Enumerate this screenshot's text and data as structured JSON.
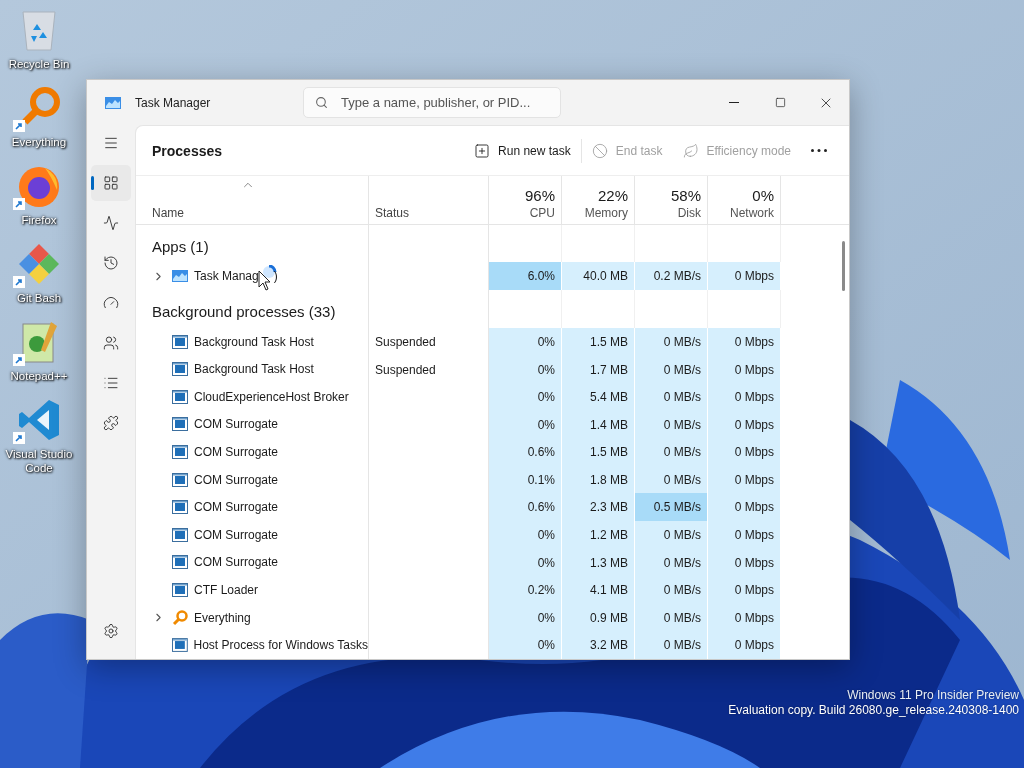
{
  "desktop_icons": [
    {
      "kind": "recycle",
      "label": "Recycle Bin",
      "shortcut": false
    },
    {
      "kind": "search",
      "label": "Everything",
      "shortcut": true
    },
    {
      "kind": "firefox",
      "label": "Firefox",
      "shortcut": true
    },
    {
      "kind": "git",
      "label": "Git Bash",
      "shortcut": true
    },
    {
      "kind": "notepad",
      "label": "Notepad++",
      "shortcut": true
    },
    {
      "kind": "vscode",
      "label": "Visual Studio Code",
      "shortcut": true
    }
  ],
  "window": {
    "title": "Task Manager",
    "search": {
      "placeholder": "Type a name, publisher, or PID..."
    }
  },
  "nav": [
    {
      "kind": "menu",
      "selected": false
    },
    {
      "kind": "processes",
      "selected": true
    },
    {
      "kind": "performance",
      "selected": false
    },
    {
      "kind": "history",
      "selected": false
    },
    {
      "kind": "startup",
      "selected": false
    },
    {
      "kind": "users",
      "selected": false
    },
    {
      "kind": "details",
      "selected": false
    },
    {
      "kind": "services",
      "selected": false
    }
  ],
  "page_title": "Processes",
  "toolbar": [
    {
      "kind": "run",
      "label": "Run new task",
      "disabled": false
    },
    {
      "kind": "end",
      "label": "End task",
      "disabled": true
    },
    {
      "kind": "efficiency",
      "label": "Efficiency mode",
      "disabled": true
    }
  ],
  "columns": [
    {
      "label": "Name"
    },
    {
      "label": "Status"
    },
    {
      "percent": "96%",
      "label": "CPU"
    },
    {
      "percent": "22%",
      "label": "Memory"
    },
    {
      "percent": "58%",
      "label": "Disk"
    },
    {
      "percent": "0%",
      "label": "Network"
    }
  ],
  "groups": [
    {
      "title": "Apps (1)",
      "rows": [
        {
          "kind": "app",
          "name": "Task Manag",
          "name_tail": ")",
          "busy": true,
          "expandable": true,
          "status": "",
          "cells": [
            {
              "text": "6.0%",
              "hot": true
            },
            {
              "text": "40.0 MB",
              "hot": false
            },
            {
              "text": "0.2 MB/s",
              "hot": false
            },
            {
              "text": "0 Mbps",
              "hot": false
            }
          ]
        }
      ]
    },
    {
      "title": "Background processes (33)",
      "rows": [
        {
          "kind": "process",
          "name": "Background Task Host",
          "busy": false,
          "expandable": false,
          "status": "Suspended",
          "cells": [
            {
              "text": "0%",
              "hot": false
            },
            {
              "text": "1.5 MB",
              "hot": false
            },
            {
              "text": "0 MB/s",
              "hot": false
            },
            {
              "text": "0 Mbps",
              "hot": false
            }
          ]
        },
        {
          "kind": "process",
          "name": "Background Task Host",
          "busy": false,
          "expandable": false,
          "status": "Suspended",
          "cells": [
            {
              "text": "0%",
              "hot": false
            },
            {
              "text": "1.7 MB",
              "hot": false
            },
            {
              "text": "0 MB/s",
              "hot": false
            },
            {
              "text": "0 Mbps",
              "hot": false
            }
          ]
        },
        {
          "kind": "process",
          "name": "CloudExperienceHost Broker",
          "busy": false,
          "expandable": false,
          "status": "",
          "cells": [
            {
              "text": "0%",
              "hot": false
            },
            {
              "text": "5.4 MB",
              "hot": false
            },
            {
              "text": "0 MB/s",
              "hot": false
            },
            {
              "text": "0 Mbps",
              "hot": false
            }
          ]
        },
        {
          "kind": "process",
          "name": "COM Surrogate",
          "busy": false,
          "expandable": false,
          "status": "",
          "cells": [
            {
              "text": "0%",
              "hot": false
            },
            {
              "text": "1.4 MB",
              "hot": false
            },
            {
              "text": "0 MB/s",
              "hot": false
            },
            {
              "text": "0 Mbps",
              "hot": false
            }
          ]
        },
        {
          "kind": "process",
          "name": "COM Surrogate",
          "busy": false,
          "expandable": false,
          "status": "",
          "cells": [
            {
              "text": "0.6%",
              "hot": false
            },
            {
              "text": "1.5 MB",
              "hot": false
            },
            {
              "text": "0 MB/s",
              "hot": false
            },
            {
              "text": "0 Mbps",
              "hot": false
            }
          ]
        },
        {
          "kind": "process",
          "name": "COM Surrogate",
          "busy": false,
          "expandable": false,
          "status": "",
          "cells": [
            {
              "text": "0.1%",
              "hot": false
            },
            {
              "text": "1.8 MB",
              "hot": false
            },
            {
              "text": "0 MB/s",
              "hot": false
            },
            {
              "text": "0 Mbps",
              "hot": false
            }
          ]
        },
        {
          "kind": "process",
          "name": "COM Surrogate",
          "busy": false,
          "expandable": false,
          "status": "",
          "cells": [
            {
              "text": "0.6%",
              "hot": false
            },
            {
              "text": "2.3 MB",
              "hot": false
            },
            {
              "text": "0.5 MB/s",
              "hot": true
            },
            {
              "text": "0 Mbps",
              "hot": false
            }
          ]
        },
        {
          "kind": "process",
          "name": "COM Surrogate",
          "busy": false,
          "expandable": false,
          "status": "",
          "cells": [
            {
              "text": "0%",
              "hot": false
            },
            {
              "text": "1.2 MB",
              "hot": false
            },
            {
              "text": "0 MB/s",
              "hot": false
            },
            {
              "text": "0 Mbps",
              "hot": false
            }
          ]
        },
        {
          "kind": "process",
          "name": "COM Surrogate",
          "busy": false,
          "expandable": false,
          "status": "",
          "cells": [
            {
              "text": "0%",
              "hot": false
            },
            {
              "text": "1.3 MB",
              "hot": false
            },
            {
              "text": "0 MB/s",
              "hot": false
            },
            {
              "text": "0 Mbps",
              "hot": false
            }
          ]
        },
        {
          "kind": "process",
          "name": "CTF Loader",
          "busy": false,
          "expandable": false,
          "status": "",
          "cells": [
            {
              "text": "0.2%",
              "hot": false
            },
            {
              "text": "4.1 MB",
              "hot": false
            },
            {
              "text": "0 MB/s",
              "hot": false
            },
            {
              "text": "0 Mbps",
              "hot": false
            }
          ]
        },
        {
          "kind": "search",
          "name": "Everything",
          "busy": false,
          "expandable": true,
          "status": "",
          "cells": [
            {
              "text": "0%",
              "hot": false
            },
            {
              "text": "0.9 MB",
              "hot": false
            },
            {
              "text": "0 MB/s",
              "hot": false
            },
            {
              "text": "0 Mbps",
              "hot": false
            }
          ]
        },
        {
          "kind": "process",
          "name": "Host Process for Windows Tasks",
          "busy": false,
          "expandable": false,
          "status": "",
          "cells": [
            {
              "text": "0%",
              "hot": false
            },
            {
              "text": "3.2 MB",
              "hot": false
            },
            {
              "text": "0 MB/s",
              "hot": false
            },
            {
              "text": "0 Mbps",
              "hot": false
            }
          ]
        }
      ]
    }
  ],
  "watermark": [
    "Windows 11 Pro Insider Preview",
    "Evaluation copy. Build 26080.ge_release.240308-1400"
  ]
}
